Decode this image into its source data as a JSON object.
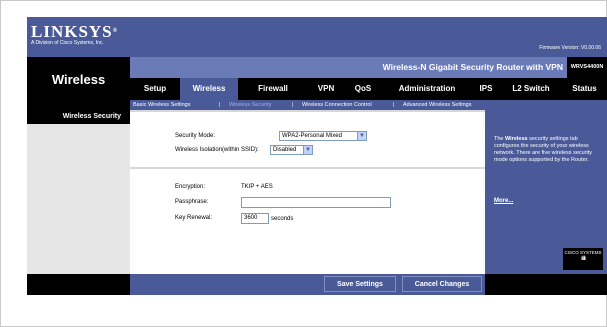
{
  "header": {
    "logo": "LINKSYS",
    "logo_reg": "®",
    "logo_subtitle": "A Division of Cisco Systems, Inc.",
    "firmware": "Firmware Version: V0.00.06"
  },
  "section_title": "Wireless",
  "product_name": "Wireless-N Gigabit Security Router with VPN",
  "model": "WRVS4400N",
  "tabs": [
    {
      "label": "Setup",
      "active": false
    },
    {
      "label": "Wireless",
      "active": true
    },
    {
      "label": "Firewall",
      "active": false
    },
    {
      "label": "VPN",
      "active": false
    },
    {
      "label": "QoS",
      "active": false
    },
    {
      "label": "Administration",
      "active": false
    },
    {
      "label": "IPS",
      "active": false
    },
    {
      "label": "L2 Switch",
      "active": false
    },
    {
      "label": "Status",
      "active": false
    }
  ],
  "subtabs": [
    {
      "label": "Basic Wireless Settings",
      "active": false
    },
    {
      "label": "Wireless Security",
      "active": true
    },
    {
      "label": "Wireless Connection Control",
      "active": false
    },
    {
      "label": "Advanced Wireless Settings",
      "active": false
    }
  ],
  "subtab_separator": "|",
  "left_title": "Wireless Security",
  "form": {
    "security_mode_label": "Security Mode:",
    "security_mode_value": "WPA2-Personal Mixed",
    "isolation_label": "Wireless Isolation(within SSID):",
    "isolation_value": "Disabled",
    "encryption_label": "Encryption:",
    "encryption_value": "TKIP + AES",
    "passphrase_label": "Passphrase:",
    "passphrase_value": "",
    "key_renewal_label": "Key Renewal:",
    "key_renewal_value": "3600",
    "key_renewal_unit": "seconds"
  },
  "help": {
    "lead": "The",
    "bold": "Wireless",
    "text": "security settings tab configures the security of your wireless network. There are five wireless security mode options supported by the Router.",
    "more": "More...",
    "cisco_label": "CISCO SYSTEMS",
    "cisco_bars": "ıılıılı"
  },
  "buttons": {
    "save": "Save Settings",
    "cancel": "Cancel Changes"
  }
}
